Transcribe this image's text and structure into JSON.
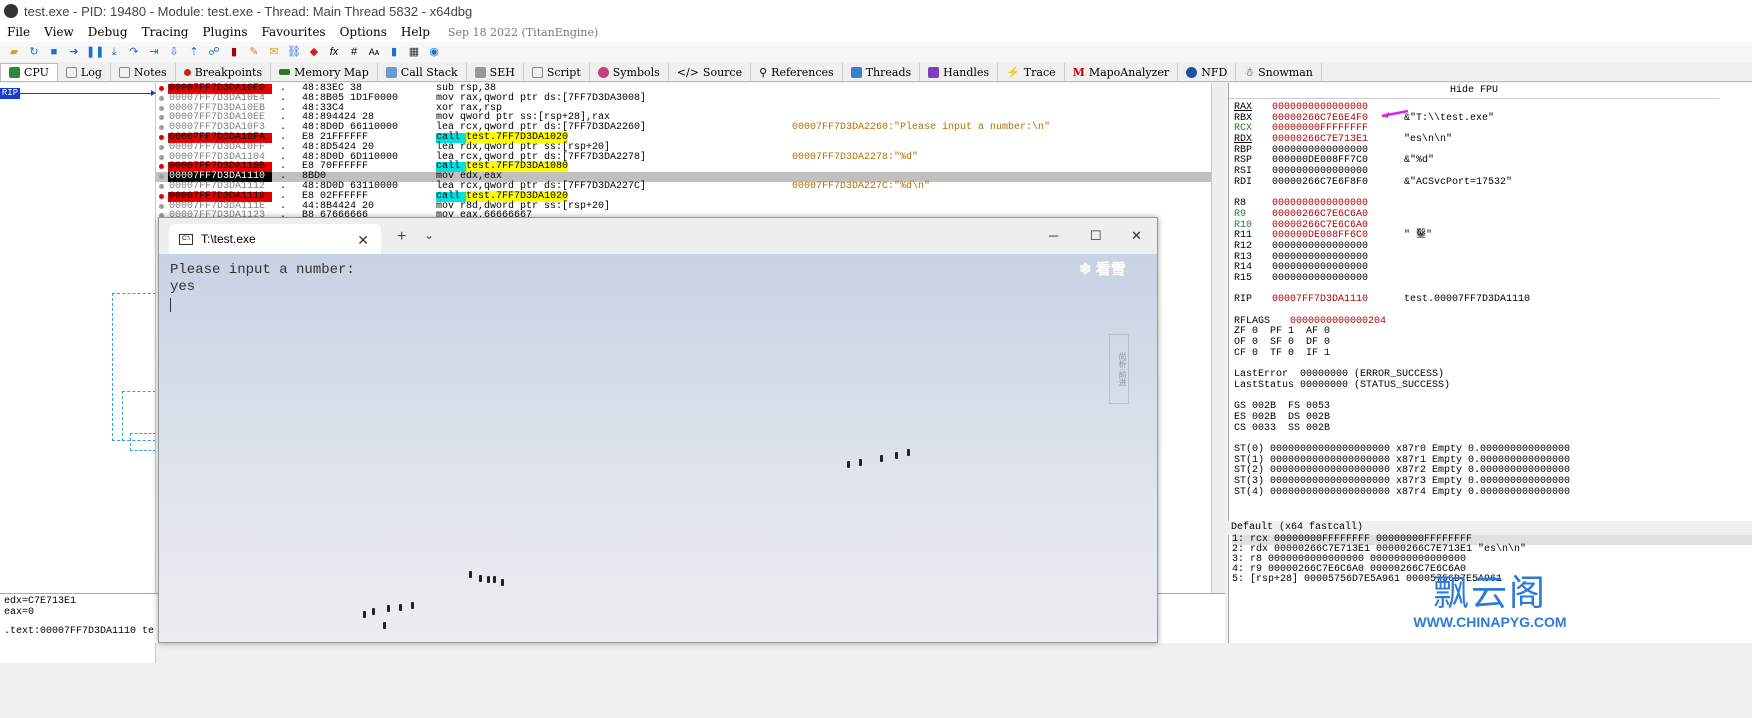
{
  "window": {
    "title": "test.exe - PID: 19480 - Module: test.exe - Thread: Main Thread 5832 - x64dbg"
  },
  "menu": {
    "items": [
      "File",
      "View",
      "Debug",
      "Tracing",
      "Plugins",
      "Favourites",
      "Options",
      "Help"
    ],
    "date": "Sep 18 2022 (TitanEngine)"
  },
  "tabs": [
    "CPU",
    "Log",
    "Notes",
    "Breakpoints",
    "Memory Map",
    "Call Stack",
    "SEH",
    "Script",
    "Symbols",
    "Source",
    "References",
    "Threads",
    "Handles",
    "Trace",
    "MapoAnalyzer",
    "NFD",
    "Snowman"
  ],
  "rip_label": "RIP",
  "disasm": [
    {
      "addr": "00007FF7D3DA10E0",
      "bytes": "48:83EC 38",
      "instr": "sub rsp,38",
      "cmt": "",
      "bp": true
    },
    {
      "addr": "00007FF7D3DA10E4",
      "bytes": "48:8B05 1D1F0000",
      "instr": "mov rax,qword ptr ds:[7FF7D3DA3008]",
      "cmt": ""
    },
    {
      "addr": "00007FF7D3DA10EB",
      "bytes": "48:33C4",
      "instr": "xor rax,rsp",
      "cmt": ""
    },
    {
      "addr": "00007FF7D3DA10EE",
      "bytes": "48:894424 28",
      "instr": "mov qword ptr ss:[rsp+28],rax",
      "cmt": ""
    },
    {
      "addr": "00007FF7D3DA10F3",
      "bytes": "48:8D0D 66110000",
      "instr": "lea rcx,qword ptr ds:[7FF7D3DA2260]",
      "cmt": "00007FF7D3DA2260:\"Please input a number:\\n\""
    },
    {
      "addr": "00007FF7D3DA10FA",
      "bytes": "E8 21FFFFFF",
      "instr": "call test.7FF7D3DA1020",
      "cmt": "",
      "bp": true
    },
    {
      "addr": "00007FF7D3DA10FF",
      "bytes": "48:8D5424 20",
      "instr": "lea rdx,qword ptr ss:[rsp+20]",
      "cmt": ""
    },
    {
      "addr": "00007FF7D3DA1104",
      "bytes": "48:8D0D 6D110000",
      "instr": "lea rcx,qword ptr ds:[7FF7D3DA2278]",
      "cmt": "00007FF7D3DA2278:\"%d\""
    },
    {
      "addr": "00007FF7D3DA110B",
      "bytes": "E8 70FFFFFF",
      "instr": "call test.7FF7D3DA1080",
      "cmt": "",
      "bp": true
    },
    {
      "addr": "00007FF7D3DA1110",
      "bytes": "8BD0",
      "instr": "mov edx,eax",
      "cmt": "",
      "current": true
    },
    {
      "addr": "00007FF7D3DA1112",
      "bytes": "48:8D0D 63110000",
      "instr": "lea rcx,qword ptr ds:[7FF7D3DA227C]",
      "cmt": "00007FF7D3DA227C:\"%d\\n\""
    },
    {
      "addr": "00007FF7D3DA1119",
      "bytes": "E8 02FFFFFF",
      "instr": "call test.7FF7D3DA1020",
      "cmt": "",
      "bp": true
    },
    {
      "addr": "00007FF7D3DA111E",
      "bytes": "44:8B4424 20",
      "instr": "mov r8d,dword ptr ss:[rsp+20]",
      "cmt": ""
    },
    {
      "addr": "00007FF7D3DA1123",
      "bytes": "B8 67666666",
      "instr": "mov eax,66666667",
      "cmt": ""
    }
  ],
  "info": {
    "line1": "edx=C7E713E1",
    "line2": "eax=0",
    "line3": ".text:00007FF7D3DA1110 te"
  },
  "registers": {
    "hide_fpu": "Hide FPU",
    "lines": [
      {
        "name": "RAX",
        "val": "0000000000000000",
        "cmt": ""
      },
      {
        "name": "RBX",
        "val": "00000266C7E6E4F0",
        "cmt": "&\"T:\\\\test.exe\""
      },
      {
        "name": "RCX",
        "val": "00000000FFFFFFFF",
        "cmt": ""
      },
      {
        "name": "RDX",
        "val": "00000266C7E713E1",
        "cmt": "\"es\\n\\n\""
      },
      {
        "name": "RBP",
        "val": "0000000000000000",
        "cmt": ""
      },
      {
        "name": "RSP",
        "val": "000000DE008FF7C0",
        "cmt": "&\"%d\""
      },
      {
        "name": "RSI",
        "val": "0000000000000000",
        "cmt": ""
      },
      {
        "name": "RDI",
        "val": "00000266C7E6F8F0",
        "cmt": "&\"ACSvcPort=17532\""
      },
      {
        "name": "",
        "val": "",
        "cmt": ""
      },
      {
        "name": "R8",
        "val": "0000000000000000",
        "cmt": ""
      },
      {
        "name": "R9",
        "val": "00000266C7E6C6A0",
        "cmt": ""
      },
      {
        "name": "R10",
        "val": "00000266C7E6C6A0",
        "cmt": ""
      },
      {
        "name": "R11",
        "val": "000000DE008FF6C0",
        "cmt": "\" 鑿\""
      },
      {
        "name": "R12",
        "val": "0000000000000000",
        "cmt": ""
      },
      {
        "name": "R13",
        "val": "0000000000000000",
        "cmt": ""
      },
      {
        "name": "R14",
        "val": "0000000000000000",
        "cmt": ""
      },
      {
        "name": "R15",
        "val": "0000000000000000",
        "cmt": ""
      },
      {
        "name": "",
        "val": "",
        "cmt": ""
      },
      {
        "name": "RIP",
        "val": "00007FF7D3DA1110",
        "cmt": "test.00007FF7D3DA1110"
      }
    ],
    "rflags_label": "RFLAGS",
    "rflags_val": "0000000000000204",
    "flags": [
      "ZF 0  PF 1  AF 0",
      "OF 0  SF 0  DF 0",
      "CF 0  TF 0  IF 1"
    ],
    "last_error": "LastError  00000000 (ERROR_SUCCESS)",
    "last_status": "LastStatus 00000000 (STATUS_SUCCESS)",
    "segs": [
      "GS 002B  FS 0053",
      "ES 002B  DS 002B",
      "CS 0033  SS 002B"
    ],
    "fpu": [
      "ST(0) 00000000000000000000 x87r0 Empty 0.000000000000000",
      "ST(1) 00000000000000000000 x87r1 Empty 0.000000000000000",
      "ST(2) 00000000000000000000 x87r2 Empty 0.000000000000000",
      "ST(3) 00000000000000000000 x87r3 Empty 0.000000000000000",
      "ST(4) 00000000000000000000 x87r4 Empty 0.000000000000000"
    ]
  },
  "callconv": "Default (x64 fastcall)",
  "callstack": [
    "1: rcx 00000000FFFFFFFF 00000000FFFFFFFF",
    "2: rdx 00000266C7E713E1 00000266C7E713E1 \"es\\n\\n\"",
    "3: r8 0000000000000000 0000000000000000",
    "4: r9 00000266C7E6C6A0 00000266C7E6C6A0",
    "5: [rsp+28] 00005756D7E5A961 00005756D7E5A961"
  ],
  "watermark": {
    "big": "飘云阁",
    "url": "WWW.CHINAPYG.COM"
  },
  "terminal": {
    "tab_title": "T:\\test.exe",
    "lines": "Please input a number:\nyes",
    "logo": "❄ 看雪",
    "seal": "尚析·前进"
  }
}
